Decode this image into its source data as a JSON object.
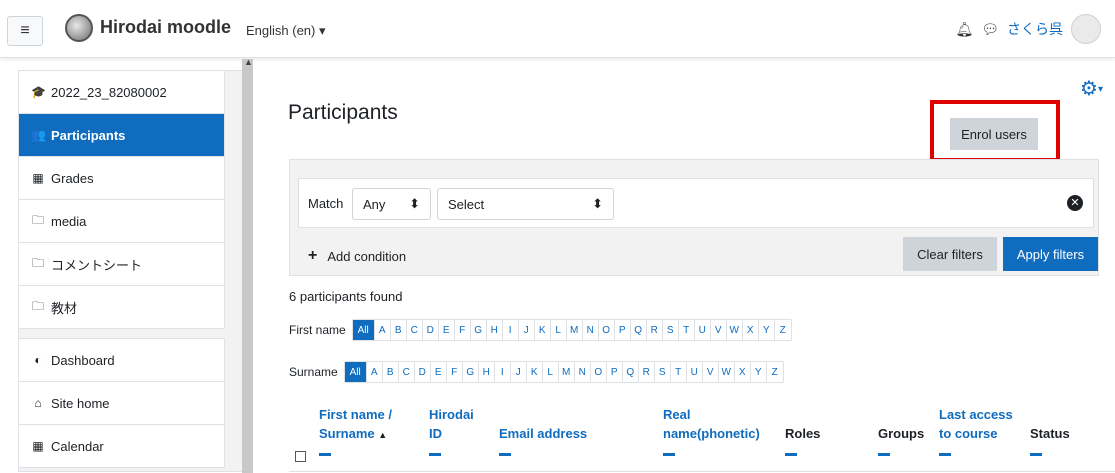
{
  "navbar": {
    "site_name": "Hirodai moodle",
    "language": "English (en) ▾",
    "user_name": "さくら呉"
  },
  "sidebar": {
    "items": [
      {
        "label": "2022_23_82080002",
        "icon": "graduation-cap-icon",
        "glyph": "🎓"
      },
      {
        "label": "Participants",
        "icon": "users-icon",
        "glyph": "👥",
        "active": true
      },
      {
        "label": "Grades",
        "icon": "table-icon",
        "glyph": "▦"
      },
      {
        "label": "media",
        "icon": "folder-icon",
        "glyph": "🗀"
      },
      {
        "label": "コメントシート",
        "icon": "folder-icon",
        "glyph": "🗀"
      },
      {
        "label": "教材",
        "icon": "folder-icon",
        "glyph": "🗀"
      }
    ],
    "nav_items": [
      {
        "label": "Dashboard",
        "icon": "dashboard-icon",
        "glyph": "◐"
      },
      {
        "label": "Site home",
        "icon": "home-icon",
        "glyph": "⌂"
      },
      {
        "label": "Calendar",
        "icon": "calendar-icon",
        "glyph": "▦"
      }
    ]
  },
  "main": {
    "title": "Participants",
    "enrol_label": "Enrol users",
    "filter": {
      "match_label": "Match",
      "match_value": "Any",
      "select_value": "Select",
      "add_condition": "Add condition",
      "clear_label": "Clear filters",
      "apply_label": "Apply filters"
    },
    "found_text": "6 participants found",
    "firstname_label": "First name",
    "surname_label": "Surname",
    "letters": [
      "All",
      "A",
      "B",
      "C",
      "D",
      "E",
      "F",
      "G",
      "H",
      "I",
      "J",
      "K",
      "L",
      "M",
      "N",
      "O",
      "P",
      "Q",
      "R",
      "S",
      "T",
      "U",
      "V",
      "W",
      "X",
      "Y",
      "Z"
    ],
    "columns": {
      "first_name": "First name /",
      "surname": "Surname",
      "hirodai": "Hirodai",
      "id": "ID",
      "email": "Email address",
      "real": "Real",
      "phonetic": "name(phonetic)",
      "roles": "Roles",
      "groups": "Groups",
      "last_access": "Last access",
      "to_course": "to course",
      "status": "Status"
    }
  },
  "colors": {
    "accent": "#0f6cbf",
    "highlight_box": "#e00000"
  }
}
